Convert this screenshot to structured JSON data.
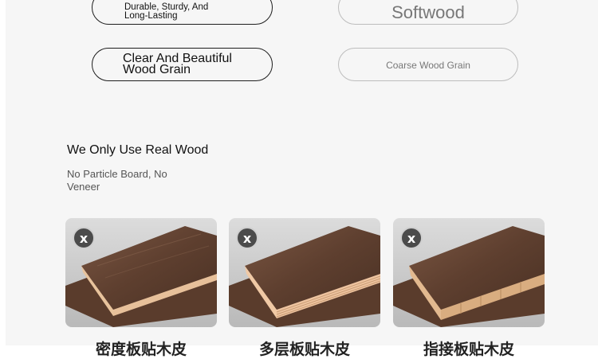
{
  "features": {
    "left_top": "Durable, Sturdy, And Long-Lasting",
    "right_top": "Softwood",
    "left_bottom": "Clear And Beautiful Wood Grain",
    "right_bottom": "Coarse Wood Grain"
  },
  "section": {
    "title": "We Only Use Real Wood",
    "subtitle": "No Particle Board, No Veneer"
  },
  "cards": [
    {
      "badge": "x",
      "caption": "密度板贴木皮"
    },
    {
      "badge": "x",
      "caption": "多层板贴木皮"
    },
    {
      "badge": "x",
      "caption": "指接板贴木皮"
    }
  ],
  "colors": {
    "panel_bg": "#f6f6f6",
    "walnut": "#6b4a38",
    "light_wood": "#e2b98f",
    "badge_bg": "#4b4b4b"
  }
}
